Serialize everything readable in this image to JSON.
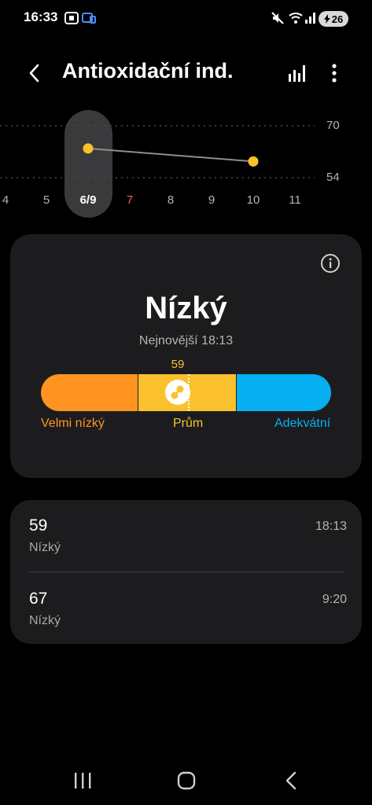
{
  "status_bar": {
    "time": "16:33",
    "battery": "26"
  },
  "header": {
    "title": "Antioxidační ind."
  },
  "chart_data": {
    "type": "line",
    "x": [
      "4",
      "5",
      "6/9",
      "7",
      "8",
      "9",
      "10",
      "11"
    ],
    "selected_label": "6/9",
    "highlight_label": "7",
    "yticks": [
      "70",
      "54"
    ],
    "ylim": [
      54,
      70
    ],
    "series": [
      {
        "points": [
          {
            "x": "6/9",
            "y": 63
          },
          {
            "x": "10",
            "y": 59
          }
        ]
      }
    ],
    "grid": true,
    "colors": {
      "point": "#fbc02d",
      "line": "#8e8e8e",
      "weekend": "#ff5b5b"
    }
  },
  "summary": {
    "level": "Nízký",
    "latest": "Nejnovější 18:13",
    "value": "59",
    "indicator_fraction": 0.5,
    "ranges": [
      {
        "label": "Velmi nízký",
        "color": "#ff9421"
      },
      {
        "label": "Prům",
        "color": "#fbc02d"
      },
      {
        "label": "Adekvátní",
        "color": "#06aef2"
      }
    ]
  },
  "records": [
    {
      "value": "59",
      "level": "Nízký",
      "time": "18:13"
    },
    {
      "value": "67",
      "level": "Nízký",
      "time": "9:20"
    }
  ],
  "icons": {
    "back": "chevron-left-icon",
    "chart": "bar-chart-icon",
    "more": "more-vertical-icon",
    "info": "info-icon",
    "marker": "antioxidant-marker-icon",
    "nav_recents": "recents-icon",
    "nav_home": "home-icon",
    "nav_back": "nav-back-icon"
  }
}
